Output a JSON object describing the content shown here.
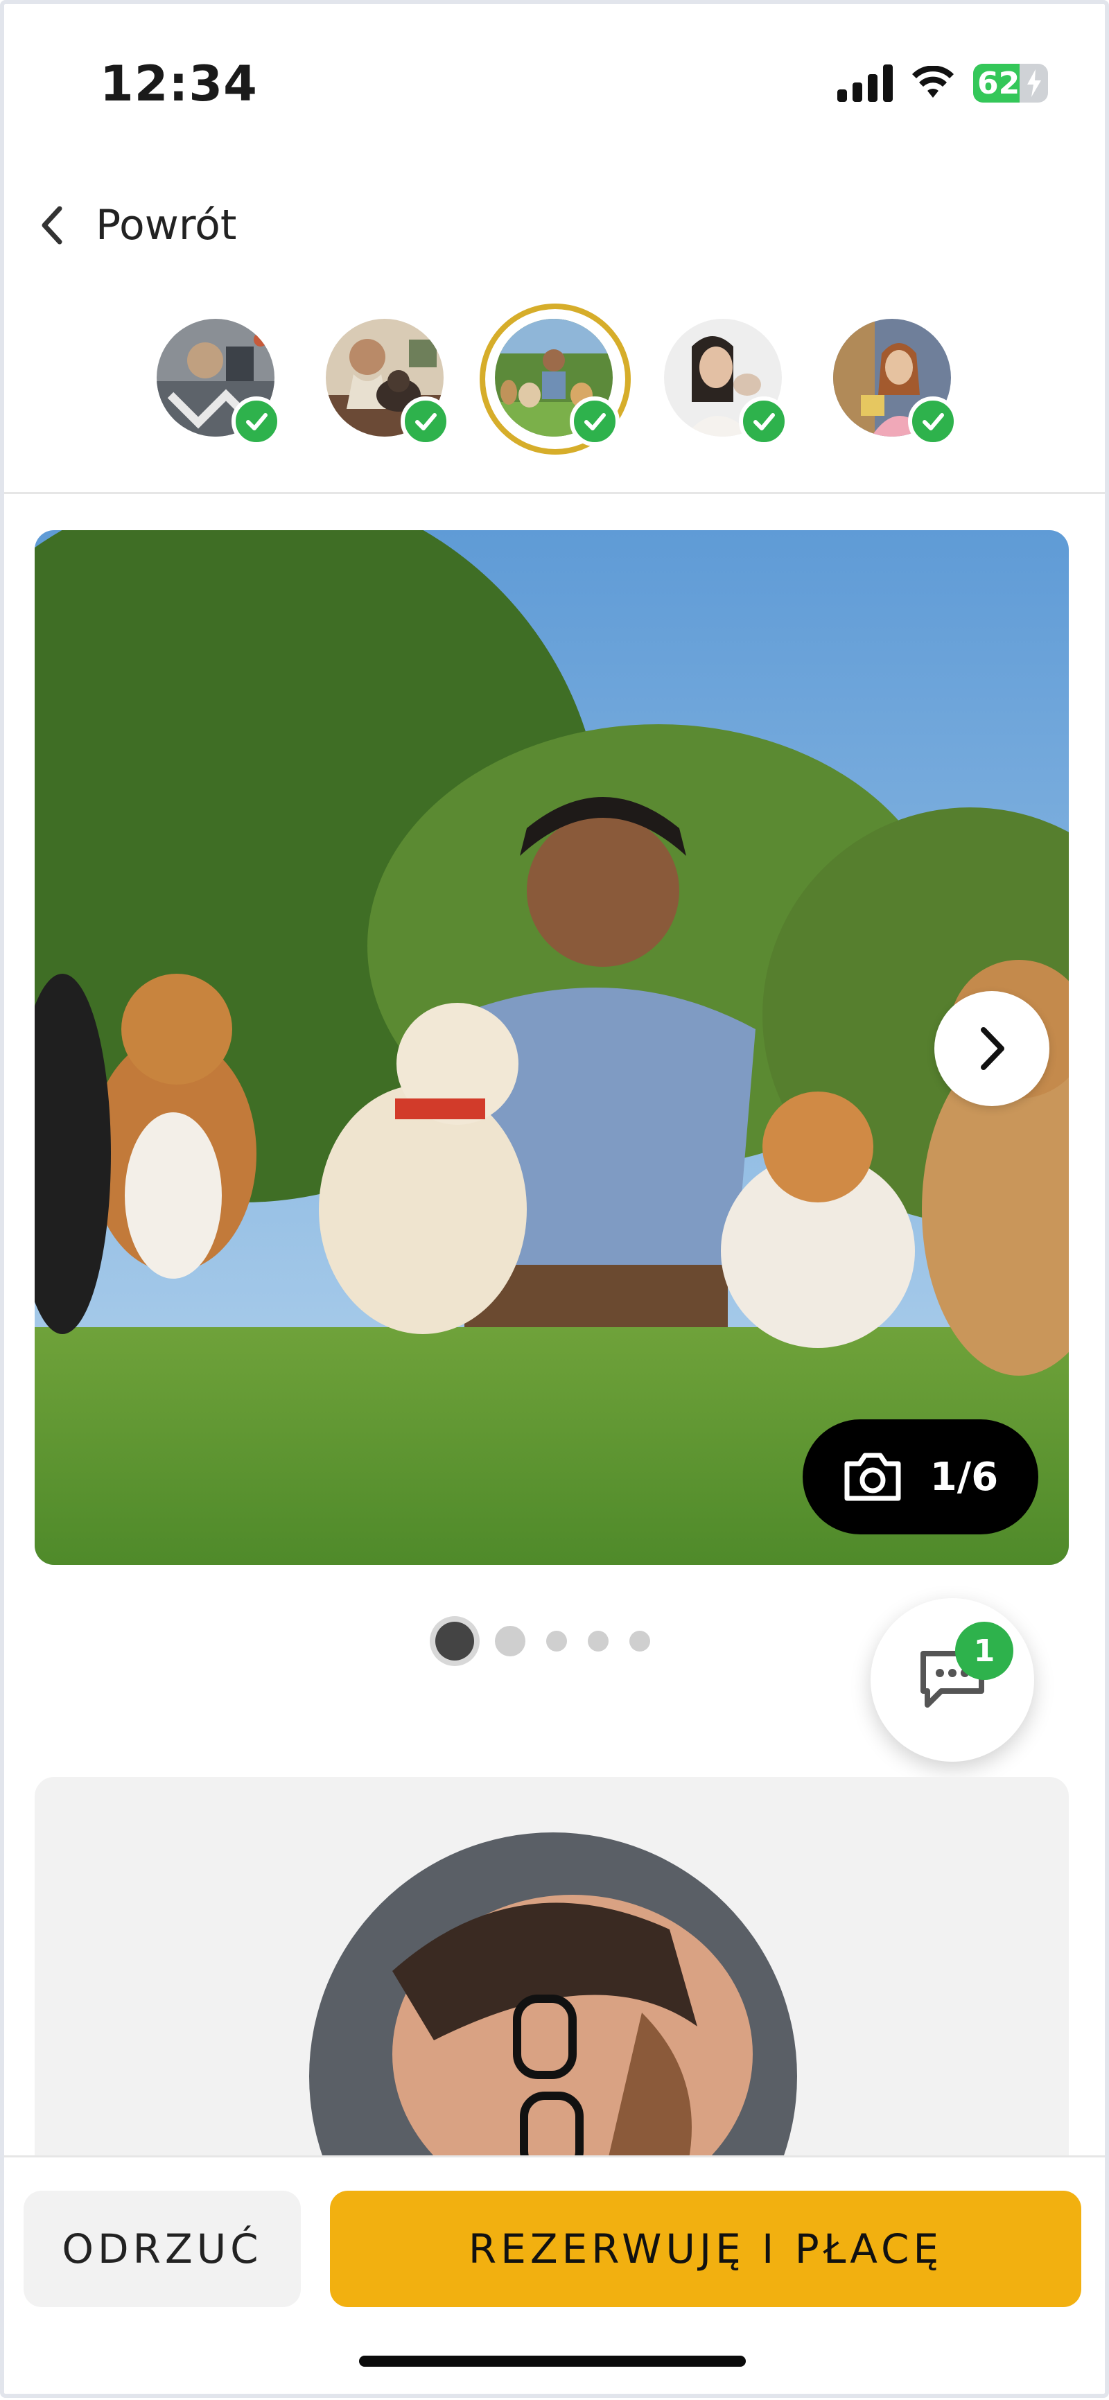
{
  "status_bar": {
    "time": "12:34",
    "battery_percent": "62"
  },
  "header": {
    "back_label": "Powrót"
  },
  "sitters": [
    {
      "name": "sitter-1",
      "checked": true,
      "active": false
    },
    {
      "name": "sitter-2",
      "checked": true,
      "active": false
    },
    {
      "name": "sitter-3",
      "checked": true,
      "active": true
    },
    {
      "name": "sitter-4",
      "checked": true,
      "active": false
    },
    {
      "name": "sitter-5",
      "checked": true,
      "active": false
    }
  ],
  "gallery": {
    "counter": "1/6",
    "current_dot": 1,
    "total_dots": 5
  },
  "chat": {
    "badge_count": "1"
  },
  "actions": {
    "reject_label": "ODRZUĆ",
    "book_label": "REZERWUJĘ I PŁACĘ"
  },
  "colors": {
    "accent": "#f2b010",
    "check": "#2eb24c",
    "active_ring": "#d6ad2a"
  }
}
